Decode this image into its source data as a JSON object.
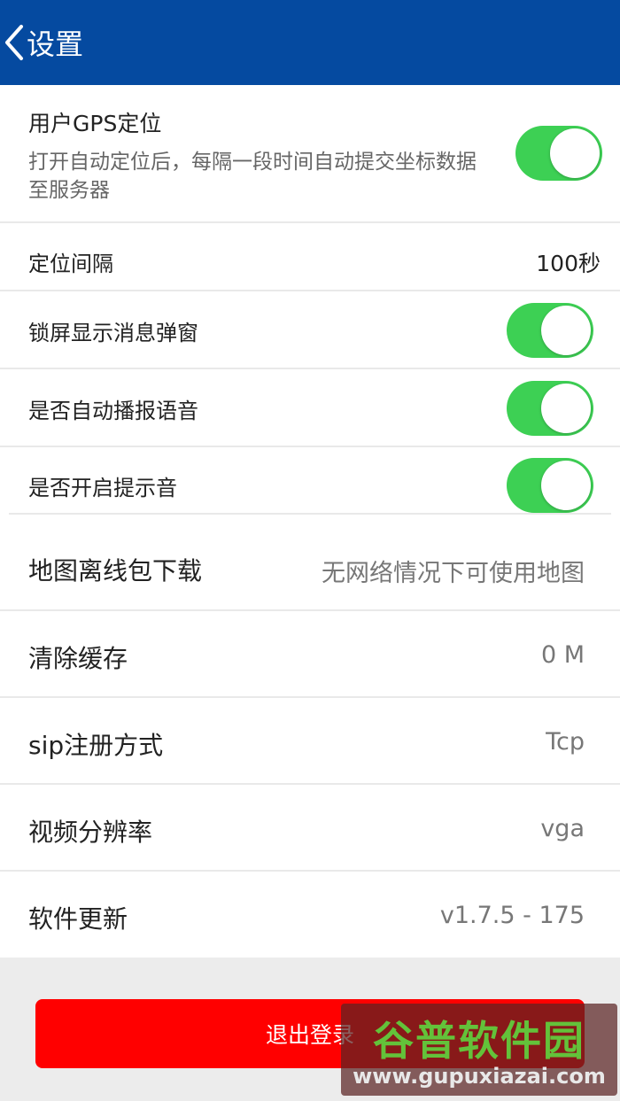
{
  "header": {
    "title": "设置",
    "back_icon": "chevron-left-icon",
    "background": "#054aa0"
  },
  "gps": {
    "title": "用户GPS定位",
    "description": "打开自动定位后，每隔一段时间自动提交坐标数据至服务器",
    "enabled": true
  },
  "interval": {
    "label": "定位间隔",
    "value": "100秒"
  },
  "toggles": [
    {
      "label": "锁屏显示消息弹窗",
      "enabled": true
    },
    {
      "label": "是否自动播报语音",
      "enabled": true
    },
    {
      "label": "是否开启提示音",
      "enabled": true
    }
  ],
  "items": [
    {
      "label": "地图离线包下载",
      "value": "无网络情况下可使用地图"
    },
    {
      "label": "清除缓存",
      "value": "0 M"
    },
    {
      "label": "sip注册方式",
      "value": "Tcp"
    },
    {
      "label": "视频分辨率",
      "value": "vga"
    },
    {
      "label": "软件更新",
      "value": "v1.7.5 - 175"
    }
  ],
  "logout": {
    "label": "退出登录",
    "color": "#ff0000"
  },
  "watermark": {
    "title": "谷普软件园",
    "url": "www.gupuxiazai.com"
  },
  "colors": {
    "toggle_on": "#3dd054",
    "separator": "#e9e9e9"
  }
}
